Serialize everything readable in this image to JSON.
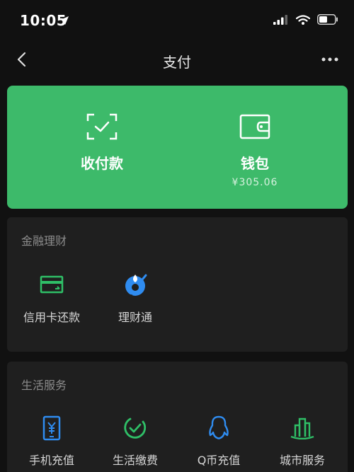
{
  "status_bar": {
    "time": "10:05"
  },
  "nav": {
    "title": "支付"
  },
  "wallet_card": {
    "receive": {
      "label": "收付款",
      "icon": "scan-check-icon"
    },
    "wallet": {
      "label": "钱包",
      "balance": "¥305.06",
      "icon": "wallet-icon"
    }
  },
  "finance": {
    "title": "金融理财",
    "items": [
      {
        "label": "信用卡还款",
        "icon": "credit-card-icon"
      },
      {
        "label": "理财通",
        "icon": "wealth-drop-icon"
      }
    ]
  },
  "life": {
    "title": "生活服务",
    "items": [
      {
        "label": "手机充值",
        "icon": "phone-recharge-icon"
      },
      {
        "label": "生活缴费",
        "icon": "bill-payment-icon"
      },
      {
        "label": "Q币充值",
        "icon": "qq-penguin-icon"
      },
      {
        "label": "城市服务",
        "icon": "city-building-icon"
      }
    ]
  },
  "colors": {
    "accent_green": "#3dba6a",
    "icon_blue": "#2f8cf0",
    "icon_green": "#2fbf67",
    "background": "#111111",
    "card": "#1f1f1f"
  }
}
